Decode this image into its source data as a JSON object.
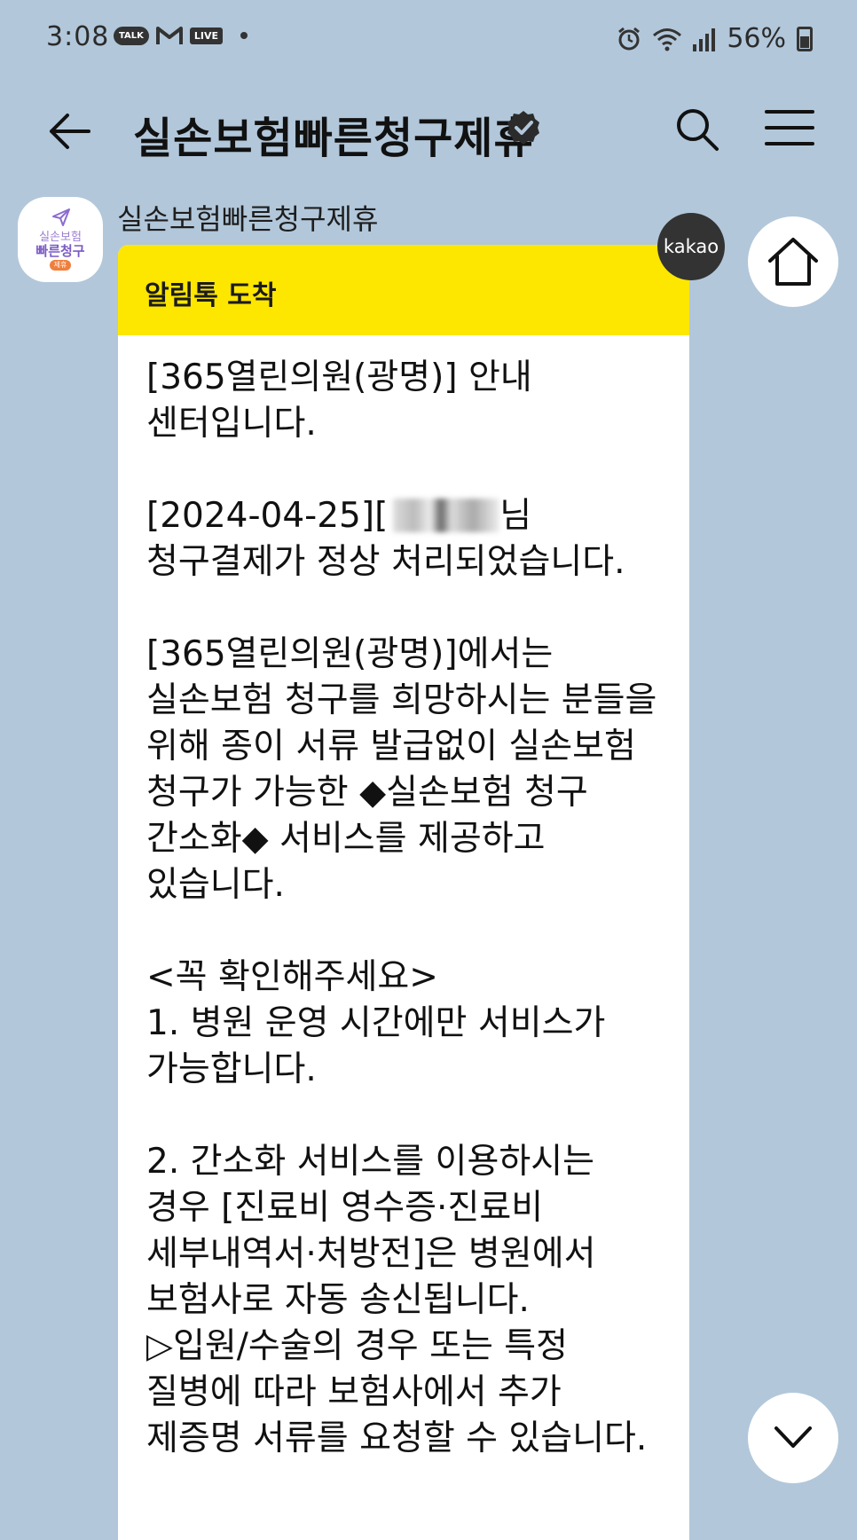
{
  "status_bar": {
    "time": "3:08",
    "talk_badge": "TALK",
    "live_badge": "LIVE",
    "battery_text": "56%",
    "icons": [
      "kakaotalk-icon",
      "gmail-icon",
      "live-icon",
      "dot-icon",
      "alarm-icon",
      "wifi-icon",
      "signal-icon",
      "battery-icon"
    ]
  },
  "header": {
    "title": "실손보험빠른청구제휴",
    "back_icon": "arrow-left-icon",
    "verified_icon": "verified-badge-icon",
    "search_icon": "search-icon",
    "menu_icon": "menu-icon"
  },
  "chat": {
    "sender_name": "실손보험빠른청구제휴",
    "avatar": {
      "line1": "실손보험",
      "line2": "빠른청구",
      "line3": "제휴"
    },
    "kakao_badge": "kakao",
    "bubble_header": "알림톡 도착",
    "message_part1": "[365열린의원(광명)] 안내\n센터입니다.\n\n[2024-04-25][",
    "message_part2": "님\n청구결제가 정상 처리되었습니다.\n\n[365열린의원(광명)]에서는\n실손보험 청구를 희망하시는 분들을\n위해 종이 서류 발급없이 실손보험\n청구가 가능한 ◆실손보험 청구\n간소화◆ 서비스를 제공하고\n있습니다.\n\n<꼭 확인해주세요>\n1. 병원 운영 시간에만 서비스가\n가능합니다.\n\n2. 간소화 서비스를 이용하시는\n경우 [진료비 영수증·진료비\n세부내역서·처방전]은 병원에서\n보험사로 자동 송신됩니다.\n▷입원/수술의 경우 또는 특정\n질병에 따라 보험사에서 추가\n제증명 서류를 요청할 수 있습니다."
  },
  "floating": {
    "home_icon": "home-icon",
    "down_icon": "chevron-down-icon"
  },
  "colors": {
    "background": "#b2c7da",
    "bubble_header": "#fde600",
    "bubble": "#ffffff",
    "avatar_purple": "#7a5bc4",
    "avatar_orange": "#f07f3c"
  }
}
